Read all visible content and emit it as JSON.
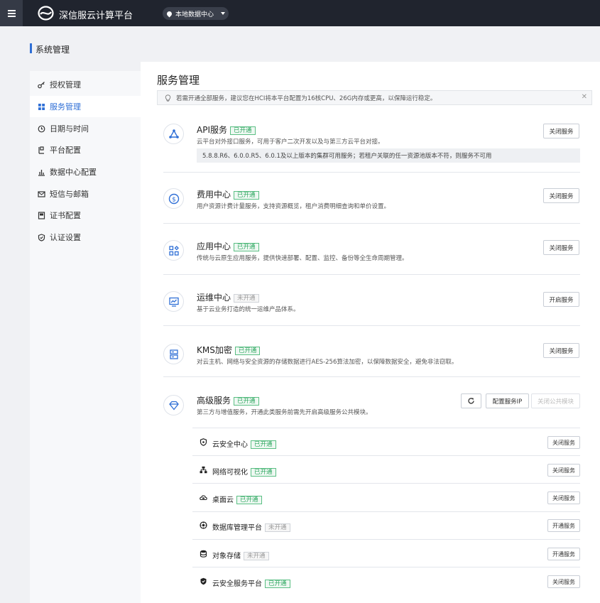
{
  "topbar": {
    "app_title": "深信服云计算平台",
    "datacenter": "本地数据中心"
  },
  "section": {
    "title": "系统管理"
  },
  "sidebar": {
    "items": [
      {
        "label": "授权管理",
        "icon": "key-icon",
        "active": false
      },
      {
        "label": "服务管理",
        "icon": "grid-icon",
        "active": true
      },
      {
        "label": "日期与时间",
        "icon": "clock-icon",
        "active": false
      },
      {
        "label": "平台配置",
        "icon": "platform-icon",
        "active": false
      },
      {
        "label": "数据中心配置",
        "icon": "bar-chart-icon",
        "active": false
      },
      {
        "label": "短信与邮箱",
        "icon": "mail-icon",
        "active": false
      },
      {
        "label": "证书配置",
        "icon": "certificate-icon",
        "active": false
      },
      {
        "label": "认证设置",
        "icon": "shield-icon",
        "active": false
      }
    ]
  },
  "main": {
    "title": "服务管理",
    "notice": "若需开通全部服务，建议您在HCI将本平台配置为16核CPU、26G内存或更高，以保障运行稳定。",
    "services": [
      {
        "name": "API服务",
        "status": "已开通",
        "desc": "云平台对外接口服务，可用于客户二次开发以及与第三方云平台对接。",
        "button": "关闭服务",
        "note": "5.8.8.R6、6.0.0.R5、6.0.1及以上版本的集群可用服务；若租户关联的任一资源池版本不符，则服务不可用"
      },
      {
        "name": "费用中心",
        "status": "已开通",
        "desc": "用户资源计费计量服务，支持资源概览，租户消费明细查询和单价设置。",
        "button": "关闭服务"
      },
      {
        "name": "应用中心",
        "status": "已开通",
        "desc": "传统与云原生应用服务，提供快速部署、配置、监控、备份等全生命周期管理。",
        "button": "关闭服务"
      },
      {
        "name": "运维中心",
        "status": "未开通",
        "desc": "基于云业务打造的统一运维产品体系。",
        "button": "开启服务"
      },
      {
        "name": "KMS加密",
        "status": "已开通",
        "desc": "对云主机、网络与安全资源的存储数据进行AES-256算法加密，以保障数据安全，避免非法窃取。",
        "button": "关闭服务"
      },
      {
        "name": "高级服务",
        "status": "已开通",
        "desc": "第三方与增值服务，开通此类服务前需先开启高级服务公共模块。",
        "refresh_icon": "refresh-icon",
        "config_button": "配置服务IP",
        "close_public_button": "关闭公共模块"
      }
    ],
    "sub_services": [
      {
        "name": "云安全中心",
        "status": "已开通",
        "button": "关闭服务"
      },
      {
        "name": "网络可视化",
        "status": "已开通",
        "button": "关闭服务"
      },
      {
        "name": "桌面云",
        "status": "已开通",
        "button": "关闭服务"
      },
      {
        "name": "数据库管理平台",
        "status": "未开通",
        "button": "开通服务"
      },
      {
        "name": "对象存储",
        "status": "未开通",
        "button": "开通服务"
      },
      {
        "name": "云安全服务平台",
        "status": "已开通",
        "button": "关闭服务"
      }
    ]
  }
}
